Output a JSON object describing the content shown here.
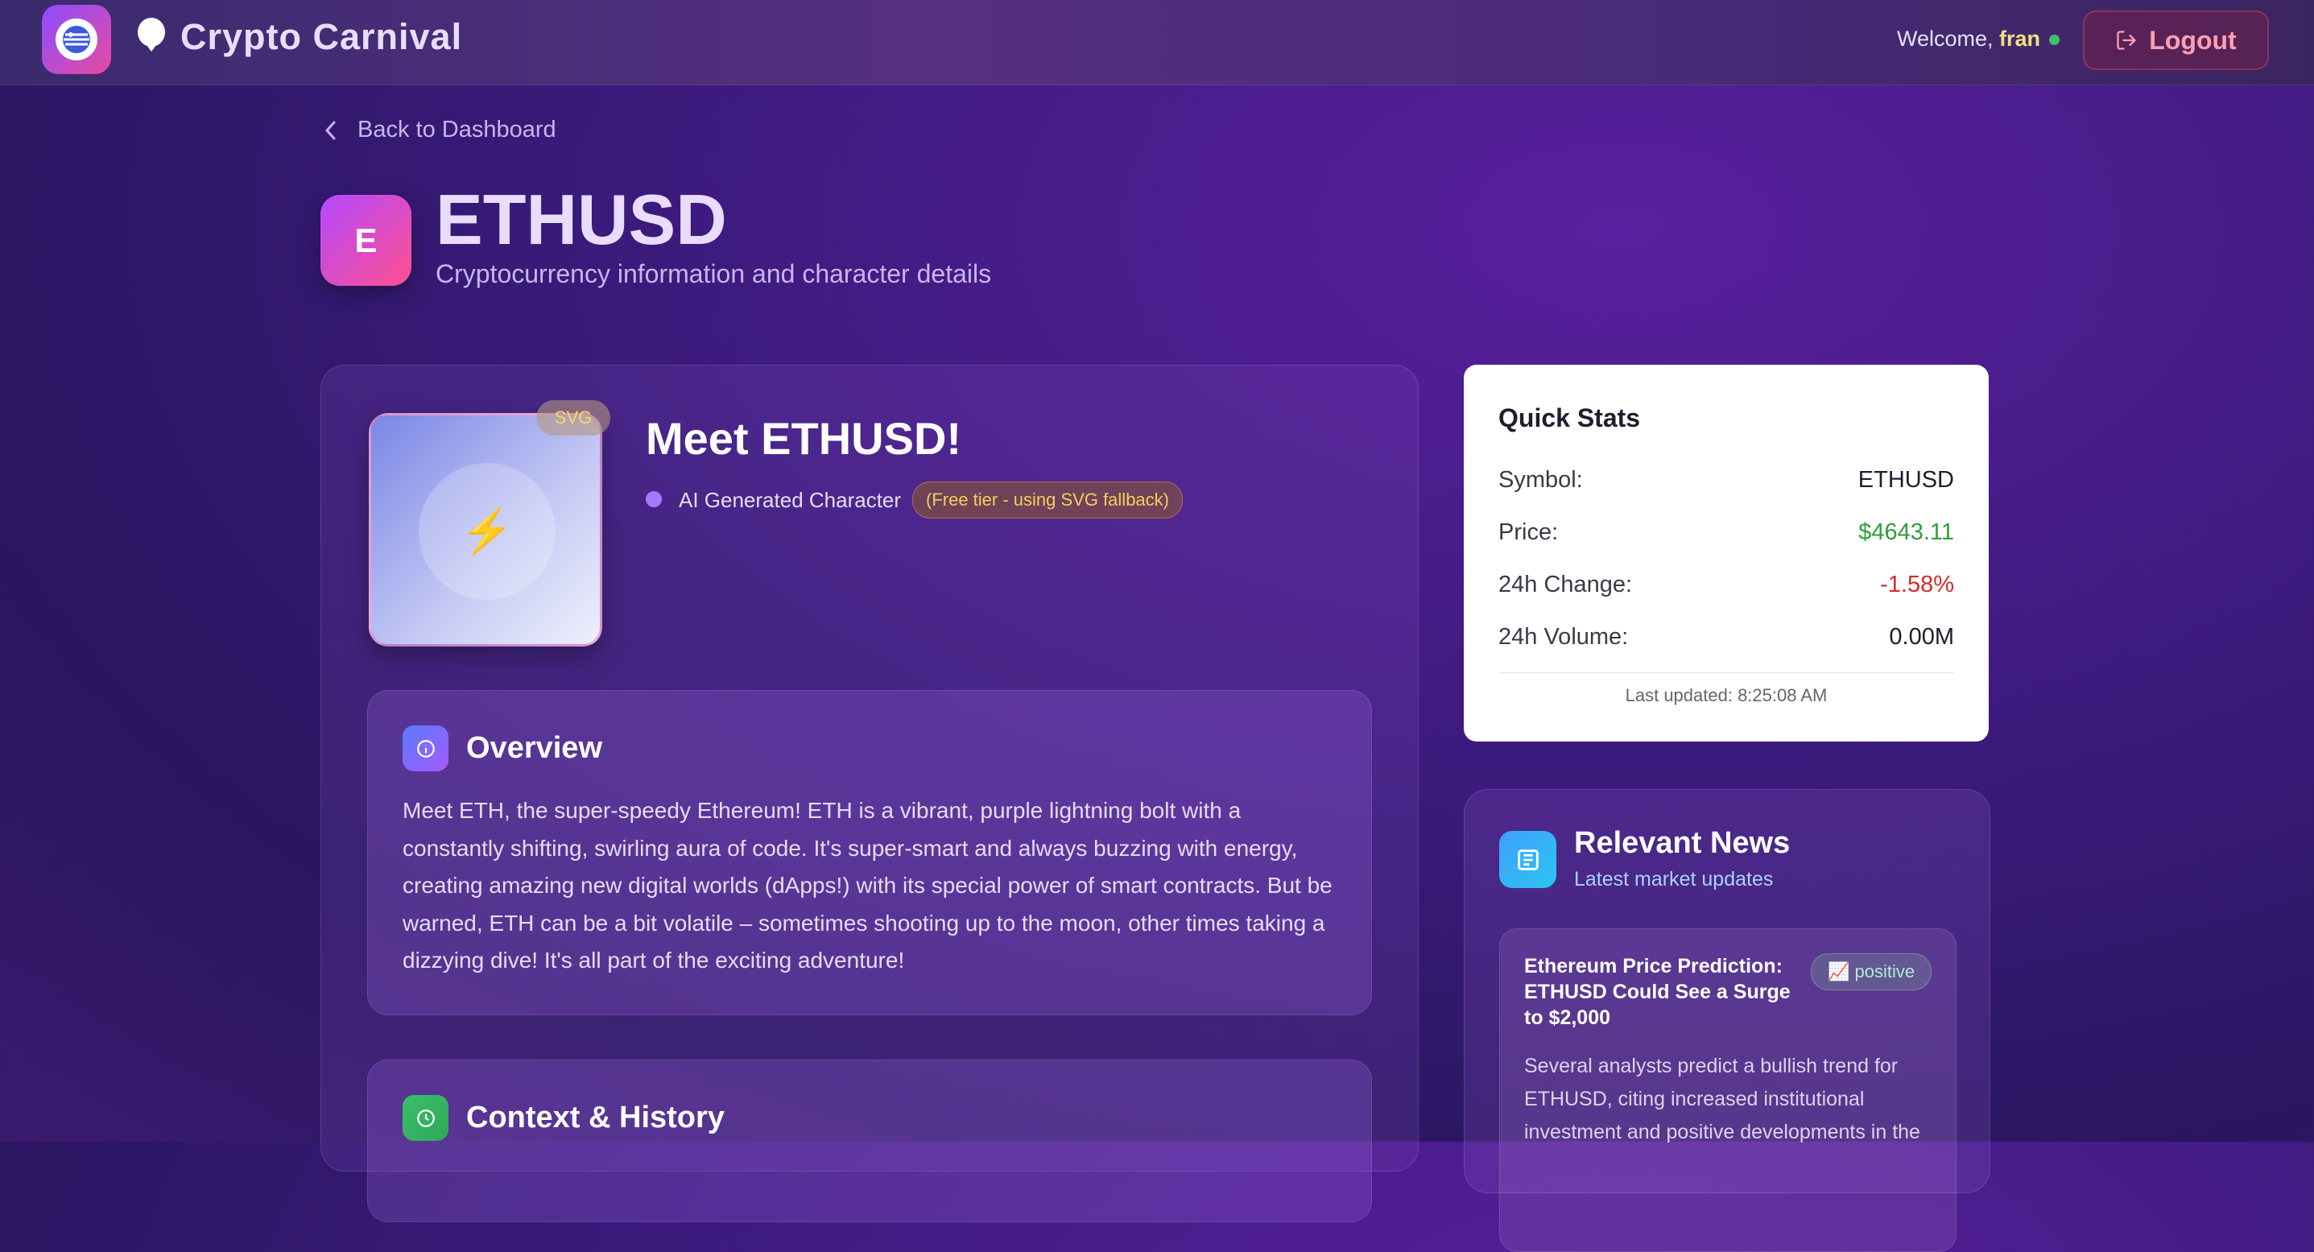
{
  "header": {
    "brand_title": "Crypto Carnival",
    "welcome_prefix": "Welcome, ",
    "username": "fran",
    "logout_label": "Logout"
  },
  "nav": {
    "back_label": "Back to Dashboard"
  },
  "page": {
    "coin_letter": "E",
    "title": "ETHUSD",
    "subtitle": "Cryptocurrency information and character details"
  },
  "character": {
    "svg_tag": "SVG",
    "meet_title": "Meet ETHUSD!",
    "ai_label": "AI Generated Character",
    "tier_badge": "(Free tier - using SVG fallback)"
  },
  "overview": {
    "title": "Overview",
    "text": "Meet ETH, the super-speedy Ethereum! ETH is a vibrant, purple lightning bolt with a constantly shifting, swirling aura of code. It's super-smart and always buzzing with energy, creating amazing new digital worlds (dApps!) with its special power of smart contracts. But be warned, ETH can be a bit volatile – sometimes shooting up to the moon, other times taking a dizzying dive! It's all part of the exciting adventure!"
  },
  "context": {
    "title": "Context & History"
  },
  "quick_stats": {
    "title": "Quick Stats",
    "rows": [
      {
        "label": "Symbol:",
        "value": "ETHUSD",
        "color": "#1e1e2e"
      },
      {
        "label": "Price:",
        "value": "$4643.11",
        "color": "#2e9e3e"
      },
      {
        "label": "24h Change:",
        "value": "-1.58%",
        "color": "#d62a2a"
      },
      {
        "label": "24h Volume:",
        "value": "0.00M",
        "color": "#1e1e2e"
      }
    ],
    "last_updated": "Last updated: 8:25:08 AM"
  },
  "news": {
    "title": "Relevant News",
    "subtitle": "Latest market updates",
    "items": [
      {
        "headline": "Ethereum Price Prediction: ETHUSD Could See a Surge to $2,000",
        "sentiment": "📈 positive",
        "body": "Several analysts predict a bullish trend for ETHUSD, citing increased institutional investment and positive developments in the"
      }
    ]
  },
  "icons": {
    "app_logo": "globe-logo-icon",
    "brand": "balloon-icon",
    "logout": "logout-icon",
    "back": "chevron-left-icon",
    "character": "lightning-icon",
    "overview": "info-icon",
    "context": "clock-icon",
    "news": "newspaper-icon"
  },
  "colors": {
    "accent_purple": "#a878ff",
    "online": "#3fbf6a",
    "price_up": "#2e9e3e",
    "price_down": "#d62a2a"
  }
}
